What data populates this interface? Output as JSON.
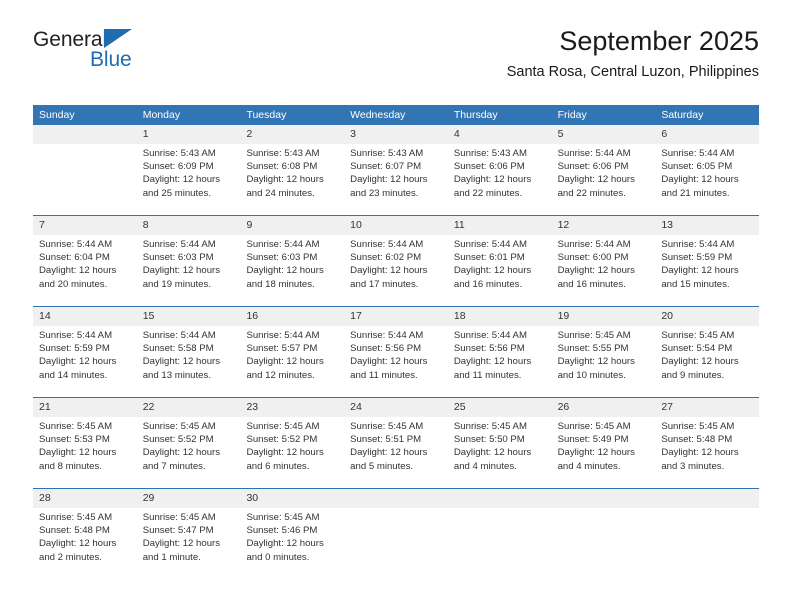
{
  "brand": {
    "name_top": "General",
    "name_bottom": "Blue",
    "color_top": "#222222",
    "color_bottom": "#1f6cb0",
    "triangle_color": "#1f6cb0"
  },
  "header": {
    "title": "September 2025",
    "subtitle": "Santa Rosa, Central Luzon, Philippines"
  },
  "theme": {
    "header_row_bg": "#3275b5",
    "header_row_text": "#ffffff",
    "daynum_band_bg": "#f0f0f0",
    "week_divider": "#2f72b2",
    "body_text": "#333333"
  },
  "calendar": {
    "weekdays": [
      "Sunday",
      "Monday",
      "Tuesday",
      "Wednesday",
      "Thursday",
      "Friday",
      "Saturday"
    ],
    "weeks": [
      {
        "days": [
          {
            "num": "",
            "lines": []
          },
          {
            "num": "1",
            "lines": [
              "Sunrise: 5:43 AM",
              "Sunset: 6:09 PM",
              "Daylight: 12 hours",
              "and 25 minutes."
            ]
          },
          {
            "num": "2",
            "lines": [
              "Sunrise: 5:43 AM",
              "Sunset: 6:08 PM",
              "Daylight: 12 hours",
              "and 24 minutes."
            ]
          },
          {
            "num": "3",
            "lines": [
              "Sunrise: 5:43 AM",
              "Sunset: 6:07 PM",
              "Daylight: 12 hours",
              "and 23 minutes."
            ]
          },
          {
            "num": "4",
            "lines": [
              "Sunrise: 5:43 AM",
              "Sunset: 6:06 PM",
              "Daylight: 12 hours",
              "and 22 minutes."
            ]
          },
          {
            "num": "5",
            "lines": [
              "Sunrise: 5:44 AM",
              "Sunset: 6:06 PM",
              "Daylight: 12 hours",
              "and 22 minutes."
            ]
          },
          {
            "num": "6",
            "lines": [
              "Sunrise: 5:44 AM",
              "Sunset: 6:05 PM",
              "Daylight: 12 hours",
              "and 21 minutes."
            ]
          }
        ]
      },
      {
        "days": [
          {
            "num": "7",
            "lines": [
              "Sunrise: 5:44 AM",
              "Sunset: 6:04 PM",
              "Daylight: 12 hours",
              "and 20 minutes."
            ]
          },
          {
            "num": "8",
            "lines": [
              "Sunrise: 5:44 AM",
              "Sunset: 6:03 PM",
              "Daylight: 12 hours",
              "and 19 minutes."
            ]
          },
          {
            "num": "9",
            "lines": [
              "Sunrise: 5:44 AM",
              "Sunset: 6:03 PM",
              "Daylight: 12 hours",
              "and 18 minutes."
            ]
          },
          {
            "num": "10",
            "lines": [
              "Sunrise: 5:44 AM",
              "Sunset: 6:02 PM",
              "Daylight: 12 hours",
              "and 17 minutes."
            ]
          },
          {
            "num": "11",
            "lines": [
              "Sunrise: 5:44 AM",
              "Sunset: 6:01 PM",
              "Daylight: 12 hours",
              "and 16 minutes."
            ]
          },
          {
            "num": "12",
            "lines": [
              "Sunrise: 5:44 AM",
              "Sunset: 6:00 PM",
              "Daylight: 12 hours",
              "and 16 minutes."
            ]
          },
          {
            "num": "13",
            "lines": [
              "Sunrise: 5:44 AM",
              "Sunset: 5:59 PM",
              "Daylight: 12 hours",
              "and 15 minutes."
            ]
          }
        ]
      },
      {
        "days": [
          {
            "num": "14",
            "lines": [
              "Sunrise: 5:44 AM",
              "Sunset: 5:59 PM",
              "Daylight: 12 hours",
              "and 14 minutes."
            ]
          },
          {
            "num": "15",
            "lines": [
              "Sunrise: 5:44 AM",
              "Sunset: 5:58 PM",
              "Daylight: 12 hours",
              "and 13 minutes."
            ]
          },
          {
            "num": "16",
            "lines": [
              "Sunrise: 5:44 AM",
              "Sunset: 5:57 PM",
              "Daylight: 12 hours",
              "and 12 minutes."
            ]
          },
          {
            "num": "17",
            "lines": [
              "Sunrise: 5:44 AM",
              "Sunset: 5:56 PM",
              "Daylight: 12 hours",
              "and 11 minutes."
            ]
          },
          {
            "num": "18",
            "lines": [
              "Sunrise: 5:44 AM",
              "Sunset: 5:56 PM",
              "Daylight: 12 hours",
              "and 11 minutes."
            ]
          },
          {
            "num": "19",
            "lines": [
              "Sunrise: 5:45 AM",
              "Sunset: 5:55 PM",
              "Daylight: 12 hours",
              "and 10 minutes."
            ]
          },
          {
            "num": "20",
            "lines": [
              "Sunrise: 5:45 AM",
              "Sunset: 5:54 PM",
              "Daylight: 12 hours",
              "and 9 minutes."
            ]
          }
        ]
      },
      {
        "days": [
          {
            "num": "21",
            "lines": [
              "Sunrise: 5:45 AM",
              "Sunset: 5:53 PM",
              "Daylight: 12 hours",
              "and 8 minutes."
            ]
          },
          {
            "num": "22",
            "lines": [
              "Sunrise: 5:45 AM",
              "Sunset: 5:52 PM",
              "Daylight: 12 hours",
              "and 7 minutes."
            ]
          },
          {
            "num": "23",
            "lines": [
              "Sunrise: 5:45 AM",
              "Sunset: 5:52 PM",
              "Daylight: 12 hours",
              "and 6 minutes."
            ]
          },
          {
            "num": "24",
            "lines": [
              "Sunrise: 5:45 AM",
              "Sunset: 5:51 PM",
              "Daylight: 12 hours",
              "and 5 minutes."
            ]
          },
          {
            "num": "25",
            "lines": [
              "Sunrise: 5:45 AM",
              "Sunset: 5:50 PM",
              "Daylight: 12 hours",
              "and 4 minutes."
            ]
          },
          {
            "num": "26",
            "lines": [
              "Sunrise: 5:45 AM",
              "Sunset: 5:49 PM",
              "Daylight: 12 hours",
              "and 4 minutes."
            ]
          },
          {
            "num": "27",
            "lines": [
              "Sunrise: 5:45 AM",
              "Sunset: 5:48 PM",
              "Daylight: 12 hours",
              "and 3 minutes."
            ]
          }
        ]
      },
      {
        "days": [
          {
            "num": "28",
            "lines": [
              "Sunrise: 5:45 AM",
              "Sunset: 5:48 PM",
              "Daylight: 12 hours",
              "and 2 minutes."
            ]
          },
          {
            "num": "29",
            "lines": [
              "Sunrise: 5:45 AM",
              "Sunset: 5:47 PM",
              "Daylight: 12 hours",
              "and 1 minute."
            ]
          },
          {
            "num": "30",
            "lines": [
              "Sunrise: 5:45 AM",
              "Sunset: 5:46 PM",
              "Daylight: 12 hours",
              "and 0 minutes."
            ]
          },
          {
            "num": "",
            "lines": []
          },
          {
            "num": "",
            "lines": []
          },
          {
            "num": "",
            "lines": []
          },
          {
            "num": "",
            "lines": []
          }
        ]
      }
    ]
  }
}
